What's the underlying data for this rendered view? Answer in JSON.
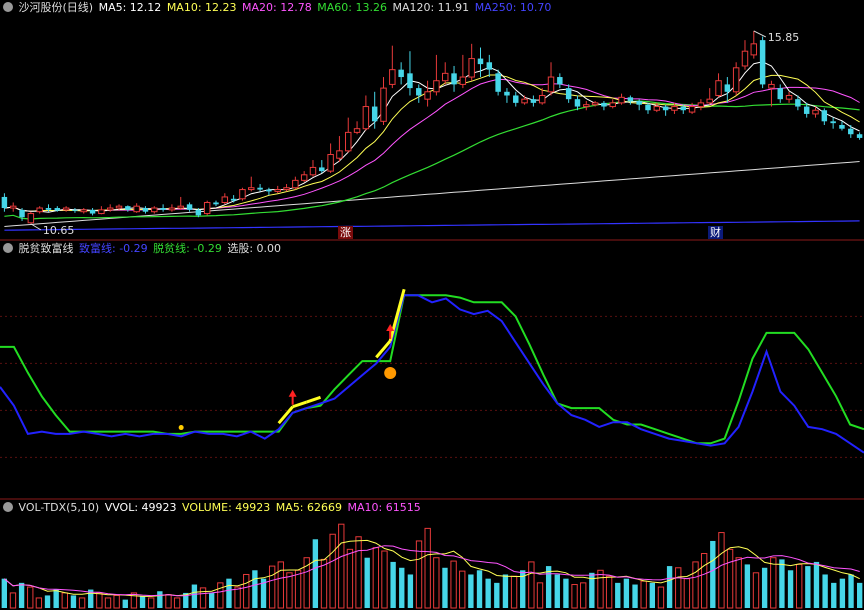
{
  "colors": {
    "up": "#e83a3a",
    "down": "#46d6e8",
    "ma5": "#ffffff",
    "ma10": "#ffff55",
    "ma20": "#ff55ff",
    "ma60": "#33dd33",
    "ma120": "#dddddd",
    "ma250": "#3333ff",
    "rich": "#2222ff",
    "poor": "#22dd22",
    "signal": "#ffff22"
  },
  "price_panel": {
    "icon": "gear-icon",
    "title": "沙河股份(日线)",
    "ma5": "MA5: 12.12",
    "ma10": "MA10: 12.23",
    "ma20": "MA20: 12.78",
    "ma60": "MA60: 13.26",
    "ma120": "MA120: 11.91",
    "ma250": "MA250: 10.70",
    "high_label": "15.85",
    "low_label": "10.65",
    "tag_rise": "涨",
    "tag_fin": "财"
  },
  "indicator_panel": {
    "icon": "gear-icon",
    "name": "脱贫致富线",
    "rich": "致富线: -0.29",
    "poor": "脱贫线: -0.29",
    "pick": "选股: 0.00"
  },
  "volume_panel": {
    "icon": "gear-icon",
    "name": "VOL-TDX(5,10)",
    "vvol": "VVOL: 49923",
    "volume": "VOLUME: 49923",
    "ma5": "MA5: 62669",
    "ma10": "MA10: 61515"
  },
  "chart_data": [
    {
      "type": "candlestick",
      "ylim": [
        10.4,
        16.2
      ],
      "candles": [
        [
          11.35,
          11.05,
          11.45,
          10.95
        ],
        [
          11.05,
          11.1,
          11.2,
          10.95
        ],
        [
          11.0,
          10.8,
          11.05,
          10.7
        ],
        [
          10.65,
          10.9,
          10.95,
          10.62
        ],
        [
          10.95,
          11.05,
          11.1,
          10.9
        ],
        [
          11.05,
          11.0,
          11.15,
          10.95
        ],
        [
          11.05,
          10.98,
          11.1,
          10.95
        ],
        [
          11.0,
          11.05,
          11.1,
          10.95
        ],
        [
          11.0,
          10.98,
          11.05,
          10.92
        ],
        [
          10.95,
          11.0,
          11.05,
          10.9
        ],
        [
          11.0,
          10.9,
          11.05,
          10.85
        ],
        [
          10.9,
          11.0,
          11.1,
          10.88
        ],
        [
          11.0,
          11.05,
          11.15,
          10.95
        ],
        [
          11.05,
          11.1,
          11.15,
          11.0
        ],
        [
          11.1,
          11.0,
          11.12,
          10.95
        ],
        [
          10.95,
          11.1,
          11.18,
          10.92
        ],
        [
          11.05,
          10.95,
          11.1,
          10.9
        ],
        [
          10.95,
          11.05,
          11.1,
          10.9
        ],
        [
          11.05,
          11.0,
          11.15,
          10.95
        ],
        [
          11.0,
          11.05,
          11.15,
          10.95
        ],
        [
          11.05,
          11.1,
          11.35,
          11.0
        ],
        [
          11.15,
          11.0,
          11.2,
          10.95
        ],
        [
          11.0,
          10.85,
          11.05,
          10.8
        ],
        [
          10.9,
          11.2,
          11.25,
          10.85
        ],
        [
          11.2,
          11.15,
          11.25,
          11.1
        ],
        [
          11.2,
          11.35,
          11.45,
          11.15
        ],
        [
          11.3,
          11.25,
          11.4,
          11.2
        ],
        [
          11.3,
          11.55,
          11.6,
          11.25
        ],
        [
          11.55,
          11.6,
          11.9,
          11.5
        ],
        [
          11.6,
          11.55,
          11.7,
          11.5
        ],
        [
          11.55,
          11.5,
          11.6,
          11.4
        ],
        [
          11.5,
          11.55,
          11.65,
          11.45
        ],
        [
          11.55,
          11.6,
          11.7,
          11.5
        ],
        [
          11.6,
          11.8,
          11.9,
          11.55
        ],
        [
          11.8,
          11.95,
          12.05,
          11.75
        ],
        [
          11.95,
          12.15,
          12.35,
          11.9
        ],
        [
          12.15,
          12.05,
          12.35,
          12.0
        ],
        [
          12.05,
          12.5,
          12.8,
          12.0
        ],
        [
          12.4,
          12.6,
          13.0,
          12.3
        ],
        [
          12.6,
          13.1,
          13.5,
          12.55
        ],
        [
          13.1,
          13.2,
          13.4,
          13.05
        ],
        [
          13.2,
          13.8,
          14.1,
          13.15
        ],
        [
          13.8,
          13.4,
          14.2,
          13.2
        ],
        [
          13.4,
          14.3,
          14.6,
          13.3
        ],
        [
          14.4,
          14.8,
          15.45,
          14.3
        ],
        [
          14.8,
          14.6,
          15.0,
          14.4
        ],
        [
          14.7,
          14.3,
          15.3,
          14.1
        ],
        [
          14.3,
          14.1,
          14.4,
          13.9
        ],
        [
          14.0,
          14.2,
          14.5,
          13.8
        ],
        [
          14.2,
          14.5,
          15.2,
          14.1
        ],
        [
          14.5,
          14.7,
          15.0,
          14.4
        ],
        [
          14.7,
          14.4,
          14.9,
          14.2
        ],
        [
          14.4,
          14.6,
          15.2,
          14.3
        ],
        [
          14.6,
          15.1,
          15.5,
          14.5
        ],
        [
          15.1,
          14.95,
          15.4,
          14.6
        ],
        [
          15.0,
          14.8,
          15.2,
          14.6
        ],
        [
          14.7,
          14.2,
          14.8,
          14.1
        ],
        [
          14.2,
          14.1,
          14.3,
          13.9
        ],
        [
          14.1,
          13.9,
          14.2,
          13.8
        ],
        [
          13.9,
          14.0,
          14.1,
          13.85
        ],
        [
          14.0,
          13.9,
          14.1,
          13.8
        ],
        [
          13.9,
          14.1,
          14.3,
          13.85
        ],
        [
          14.2,
          14.6,
          15.0,
          14.1
        ],
        [
          14.6,
          14.4,
          14.7,
          14.3
        ],
        [
          14.3,
          14.0,
          14.4,
          13.9
        ],
        [
          14.0,
          13.8,
          14.1,
          13.7
        ],
        [
          13.8,
          13.85,
          13.95,
          13.7
        ],
        [
          13.85,
          13.9,
          13.95,
          13.8
        ],
        [
          13.9,
          13.8,
          13.95,
          13.7
        ],
        [
          13.8,
          13.9,
          14.0,
          13.75
        ],
        [
          13.9,
          14.05,
          14.15,
          13.85
        ],
        [
          14.05,
          13.95,
          14.1,
          13.85
        ],
        [
          13.95,
          13.85,
          14.0,
          13.7
        ],
        [
          13.85,
          13.7,
          13.9,
          13.6
        ],
        [
          13.7,
          13.8,
          13.9,
          13.65
        ],
        [
          13.8,
          13.7,
          13.85,
          13.55
        ],
        [
          13.7,
          13.8,
          13.9,
          13.6
        ],
        [
          13.8,
          13.7,
          13.85,
          13.6
        ],
        [
          13.65,
          13.8,
          13.9,
          13.6
        ],
        [
          13.8,
          13.9,
          14.0,
          13.7
        ],
        [
          13.9,
          14.0,
          14.3,
          13.85
        ],
        [
          14.1,
          14.5,
          14.7,
          14.05
        ],
        [
          14.4,
          14.2,
          14.6,
          13.9
        ],
        [
          14.2,
          14.85,
          15.0,
          14.1
        ],
        [
          14.9,
          15.3,
          15.6,
          14.8
        ],
        [
          15.2,
          15.5,
          15.85,
          15.1
        ],
        [
          15.6,
          14.4,
          15.7,
          14.3
        ],
        [
          14.3,
          14.4,
          14.5,
          13.8
        ],
        [
          14.3,
          14.0,
          14.4,
          13.9
        ],
        [
          14.0,
          14.1,
          14.2,
          13.9
        ],
        [
          14.0,
          13.8,
          14.1,
          13.7
        ],
        [
          13.8,
          13.6,
          13.9,
          13.5
        ],
        [
          13.6,
          13.7,
          13.8,
          13.5
        ],
        [
          13.7,
          13.4,
          13.75,
          13.3
        ],
        [
          13.4,
          13.35,
          13.5,
          13.2
        ],
        [
          13.3,
          13.2,
          13.4,
          13.15
        ],
        [
          13.2,
          13.05,
          13.3,
          12.95
        ],
        [
          13.05,
          12.95,
          13.1,
          12.9
        ]
      ],
      "ma_values": {
        "MA5": 12.12,
        "MA10": 12.23,
        "MA20": 12.78,
        "MA60": 13.26,
        "MA120": 11.91,
        "MA250": 10.7
      },
      "annotations": [
        "15.85",
        "10.65"
      ]
    },
    {
      "type": "line",
      "series": [
        {
          "name": "致富线",
          "values": [
            -0.5,
            -0.9,
            -1.5,
            -1.45,
            -1.5,
            -1.5,
            -1.45,
            -1.5,
            -1.55,
            -1.5,
            -1.55,
            -1.5,
            -1.5,
            -1.55,
            -1.45,
            -1.5,
            -1.5,
            -1.55,
            -1.45,
            -1.6,
            -1.4,
            -1.05,
            -0.95,
            -0.85,
            -0.75,
            -0.5,
            -0.25,
            0.0,
            0.35,
            1.45,
            1.45,
            1.3,
            1.38,
            1.15,
            1.05,
            1.12,
            0.9,
            0.45,
            0.0,
            -0.45,
            -0.85,
            -1.1,
            -1.2,
            -1.35,
            -1.25,
            -1.25,
            -1.4,
            -1.5,
            -1.6,
            -1.65,
            -1.7,
            -1.75,
            -1.7,
            -1.35,
            -0.6,
            0.25,
            -0.6,
            -0.9,
            -1.35,
            -1.4,
            -1.5,
            -1.7,
            -1.9
          ]
        },
        {
          "name": "脱贫线",
          "values": [
            0.35,
            0.35,
            -0.2,
            -0.7,
            -1.1,
            -1.45,
            -1.45,
            -1.45,
            -1.45,
            -1.45,
            -1.45,
            -1.45,
            -1.5,
            -1.5,
            -1.45,
            -1.45,
            -1.45,
            -1.45,
            -1.45,
            -1.45,
            -1.45,
            -1.05,
            -0.95,
            -0.9,
            -0.55,
            -0.25,
            0.05,
            0.05,
            0.05,
            1.45,
            1.45,
            1.45,
            1.45,
            1.4,
            1.3,
            1.3,
            1.3,
            1.0,
            0.4,
            -0.25,
            -0.85,
            -0.95,
            -0.95,
            -0.95,
            -1.2,
            -1.3,
            -1.3,
            -1.4,
            -1.5,
            -1.6,
            -1.7,
            -1.7,
            -1.6,
            -0.8,
            0.1,
            0.65,
            0.65,
            0.65,
            0.3,
            -0.2,
            -0.7,
            -1.3,
            -1.4
          ]
        }
      ],
      "ylim": [
        -2.8,
        2.2
      ],
      "legend": "top-left"
    },
    {
      "type": "bar",
      "series": [
        {
          "name": "VOLUME",
          "values": [
            35,
            18,
            30,
            25,
            12,
            15,
            22,
            18,
            15,
            12,
            22,
            18,
            12,
            15,
            10,
            18,
            14,
            12,
            20,
            16,
            12,
            18,
            28,
            24,
            18,
            30,
            35,
            25,
            40,
            45,
            35,
            50,
            55,
            42,
            45,
            60,
            82,
            58,
            88,
            100,
            70,
            85,
            60,
            72,
            68,
            55,
            48,
            40,
            80,
            95,
            60,
            48,
            56,
            44,
            40,
            45,
            35,
            30,
            40,
            38,
            45,
            55,
            30,
            50,
            40,
            35,
            28,
            30,
            42,
            45,
            38,
            30,
            35,
            28,
            32,
            30,
            25,
            50,
            48,
            35,
            55,
            65,
            80,
            90,
            70,
            60,
            52,
            42,
            48,
            60,
            58,
            45,
            52,
            50,
            55,
            40,
            30,
            35,
            40,
            30
          ]
        }
      ],
      "legend": "top-left"
    }
  ]
}
